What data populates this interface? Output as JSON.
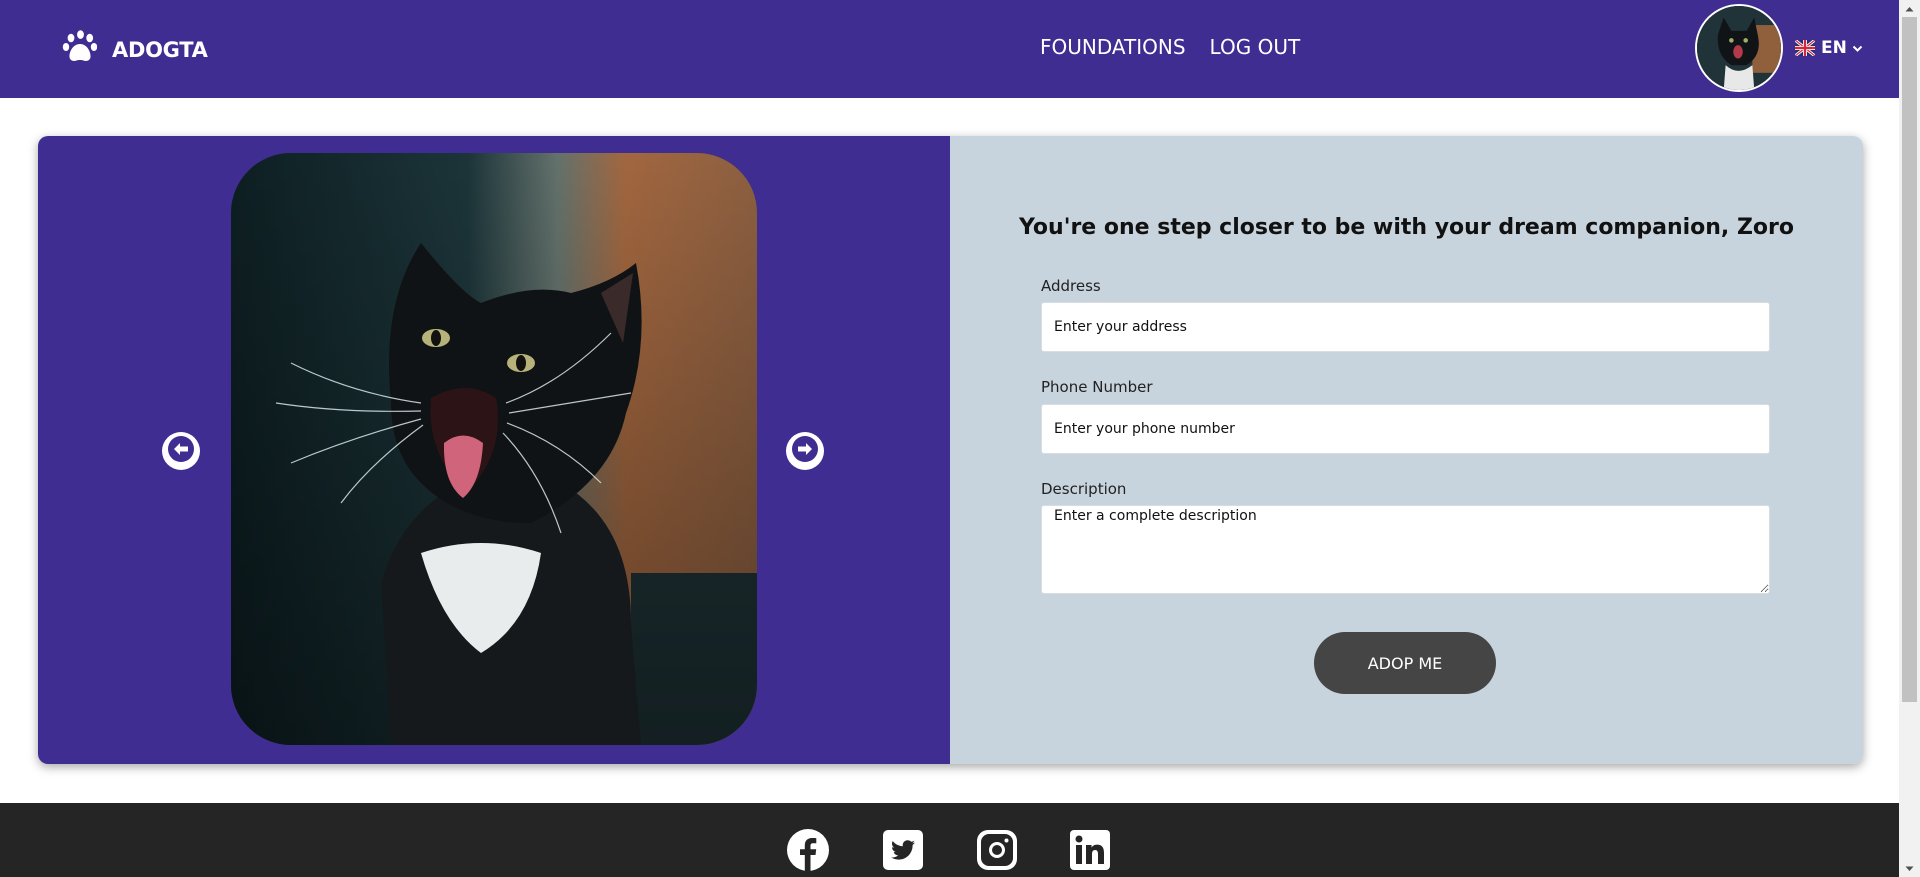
{
  "header": {
    "brand": "ADOGTA",
    "nav": [
      {
        "label": "FOUNDATIONS"
      },
      {
        "label": "LOG OUT"
      }
    ],
    "language": "EN"
  },
  "form": {
    "title": "You're one step closer to be with your dream companion, Zoro",
    "address": {
      "label": "Address",
      "placeholder": "Enter your address"
    },
    "phone": {
      "label": "Phone Number",
      "placeholder": "Enter your phone number"
    },
    "description": {
      "label": "Description",
      "placeholder": "Enter a complete description"
    },
    "submit_label": "ADOP ME"
  },
  "colors": {
    "brand": "#3f2d91",
    "form_panel": "#c7d3dd",
    "button": "#454545",
    "footer": "#252525"
  },
  "icons": {
    "logo": "paw-icon",
    "carousel_prev": "arrow-left-circle-icon",
    "carousel_next": "arrow-right-circle-icon",
    "socials": [
      "facebook-icon",
      "twitter-icon",
      "instagram-icon",
      "linkedin-icon"
    ]
  }
}
